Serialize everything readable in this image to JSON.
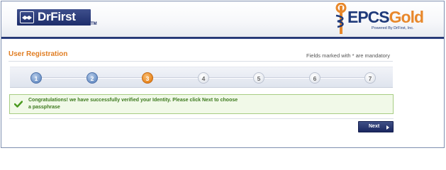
{
  "header": {
    "left_logo_text": "DrFirst",
    "left_logo_tm": "TM",
    "right_logo": {
      "prefix": "EPCS",
      "suffix": "Gold",
      "tagline": "Powered By DrFirst, Inc."
    }
  },
  "registration": {
    "title": "User Registration",
    "mandatory_note": "Fields marked with * are mandatory"
  },
  "stepper": {
    "current_step": 3,
    "steps": [
      {
        "label": "1",
        "state": "done"
      },
      {
        "label": "2",
        "state": "done"
      },
      {
        "label": "3",
        "state": "current"
      },
      {
        "label": "4",
        "state": "todo"
      },
      {
        "label": "5",
        "state": "todo"
      },
      {
        "label": "6",
        "state": "todo"
      },
      {
        "label": "7",
        "state": "todo"
      }
    ]
  },
  "message": {
    "icon": "check-icon",
    "text": "Congratulations! we have successfully verified your Identity. Please click Next to choose a passphrase"
  },
  "actions": {
    "next_label": "Next"
  },
  "colors": {
    "brand_navy": "#1d2d6b",
    "accent_orange": "#e07d22",
    "success_green": "#3d7a1e"
  }
}
